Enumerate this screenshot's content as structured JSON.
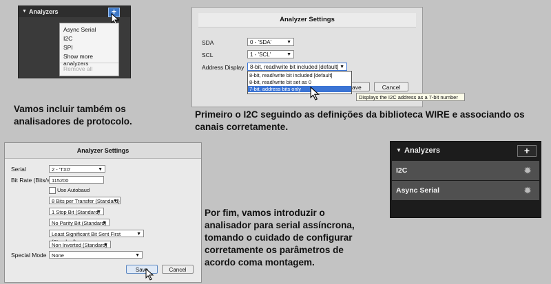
{
  "panel1": {
    "header_title": "Analyzers",
    "add_label": "+",
    "menu_items": [
      "Async Serial",
      "I2C",
      "SPI",
      "Show more analyzers",
      "Remove all"
    ]
  },
  "caption1": [
    "Vamos incluir também os",
    "analisadores de protocolo."
  ],
  "panel2": {
    "title": "Analyzer Settings",
    "sda_label": "SDA",
    "sda_value": "0 - 'SDA'",
    "scl_label": "SCL",
    "scl_value": "1 - 'SCL'",
    "address_label": "Address Display",
    "address_value": "8-bit, read/write bit included [default]",
    "options": [
      "8-bit, read/write bit included [default]",
      "8-bit, read/write bit set as 0",
      "7-bit, address bits only"
    ],
    "save_label": "Save",
    "cancel_label": "Cancel",
    "tooltip": "Displays the I2C address as a 7-bit number"
  },
  "caption2": [
    "Primeiro o I2C seguindo as definições da biblioteca WIRE e associando os",
    "canais corretamente."
  ],
  "panel3": {
    "title": "Analyzer Settings",
    "serial_label": "Serial",
    "serial_value": "2 - 'TX0'",
    "bitrate_label": "Bit Rate (Bits/s)",
    "bitrate_value": "115200",
    "autobaud_label": "Use Autobaud",
    "bits_per_transfer": "8 Bits per Transfer (Standard)",
    "stop_bit": "1 Stop Bit (Standard)",
    "parity": "No Parity Bit (Standard)",
    "bit_order": "Least Significant Bit Sent First (Standard)",
    "inversion": "Non Inverted (Standard)",
    "special_mode_label": "Special Mode",
    "special_mode_value": "None",
    "save_label": "Save",
    "cancel_label": "Cancel"
  },
  "caption3": [
    "Por fim, vamos introduzir o",
    "analisador para serial assíncrona,",
    "tomando o cuidado de configurar",
    "corretamente os parâmetros de",
    "acordo coma montagem."
  ],
  "panel4": {
    "header_title": "Analyzers",
    "add_label": "+",
    "rows": [
      "I2C",
      "Async Serial"
    ]
  }
}
